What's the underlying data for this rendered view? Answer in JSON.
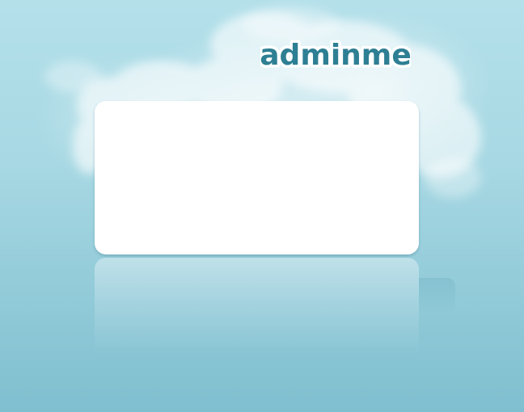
{
  "brand": {
    "logo_text": "adminme",
    "logo_fill": "#2e7f93",
    "logo_outline": "#ffffff"
  },
  "colors": {
    "sky_top": "#b4e0ea",
    "sky_bottom": "#7fbfcf",
    "card": "#ffffff"
  },
  "card": {
    "content": ""
  }
}
